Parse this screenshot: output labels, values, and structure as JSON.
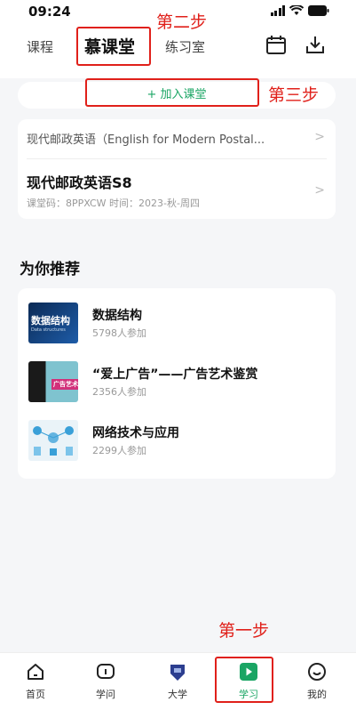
{
  "status": {
    "time": "09:24"
  },
  "tabs": [
    {
      "label": "课程"
    },
    {
      "label": "慕课堂"
    },
    {
      "label": "练习室"
    }
  ],
  "join": {
    "label": "+ 加入课堂"
  },
  "courses": {
    "first": {
      "title": "现代邮政英语（English for Modern Postal..."
    },
    "second": {
      "title": "现代邮政英语S8",
      "meta": "课堂码：8PPXCW  时间：2023-秋-周四"
    }
  },
  "recommend": {
    "title": "为你推荐",
    "items": [
      {
        "name": "数据结构",
        "count": "5798人参加",
        "thumb_text": "数据结构",
        "thumb_sub": "Data structures"
      },
      {
        "name": "“爱上广告”——广告艺术鉴赏",
        "count": "2356人参加",
        "thumb_text": "广告艺术"
      },
      {
        "name": "网络技术与应用",
        "count": "2299人参加"
      }
    ]
  },
  "annotations": {
    "step1": "第一步",
    "step2": "第二步",
    "step3": "第三步"
  },
  "nav": [
    {
      "label": "首页",
      "icon": "home-icon"
    },
    {
      "label": "学问",
      "icon": "chat-icon"
    },
    {
      "label": "大学",
      "icon": "university-icon"
    },
    {
      "label": "学习",
      "icon": "play-icon"
    },
    {
      "label": "我的",
      "icon": "smile-icon"
    }
  ],
  "colors": {
    "accent": "#1aa564",
    "annotation": "#e0201a"
  }
}
